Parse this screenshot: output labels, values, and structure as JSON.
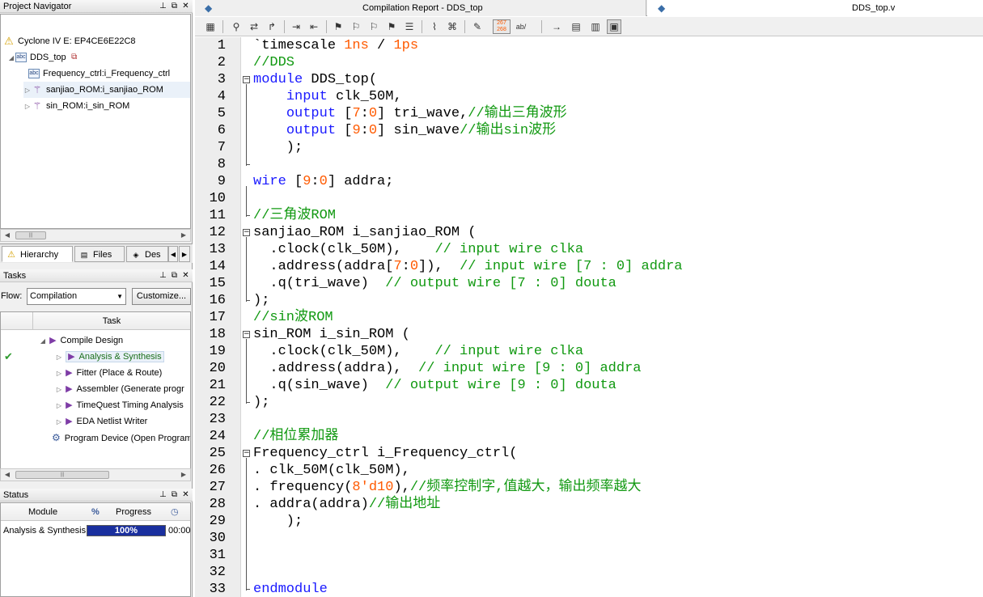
{
  "project_navigator": {
    "title": "Project Navigator",
    "device": "Cyclone IV E: EP4CE6E22C8",
    "top_entity": "DDS_top",
    "children": [
      "Frequency_ctrl:i_Frequency_ctrl",
      "sanjiao_ROM:i_sanjiao_ROM",
      "sin_ROM:i_sin_ROM"
    ],
    "tabs": [
      "Hierarchy",
      "Files",
      "Des"
    ]
  },
  "tasks": {
    "title": "Tasks",
    "flow_label": "Flow:",
    "flow_value": "Compilation",
    "customize_label": "Customize...",
    "column_header": "Task",
    "items": [
      "Compile Design",
      "Analysis & Synthesis",
      "Fitter (Place & Route)",
      "Assembler (Generate progr",
      "TimeQuest Timing Analysis",
      "EDA Netlist Writer",
      "Program Device (Open Program"
    ]
  },
  "status": {
    "title": "Status",
    "col_module": "Module",
    "col_pct": "%",
    "col_progress": "Progress",
    "row_module": "Analysis & Synthesis",
    "row_progress": "100%",
    "row_progress_value": 100,
    "row_time": "00:00"
  },
  "doc_tabs": {
    "compilation_report": "Compilation Report - DDS_top",
    "source_file": "DDS_top.v"
  },
  "editor": {
    "line_numbers": [
      "1",
      "2",
      "3",
      "4",
      "5",
      "6",
      "7",
      "8",
      "9",
      "10",
      "11",
      "12",
      "13",
      "14",
      "15",
      "16",
      "17",
      "18",
      "19",
      "20",
      "21",
      "22",
      "23",
      "24",
      "25",
      "26",
      "27",
      "28",
      "29",
      "30",
      "31",
      "32",
      "33"
    ],
    "lines": [
      "`timescale 1ns / 1ps",
      "//DDS",
      "module DDS_top(",
      "    input clk_50M,",
      "    output [7:0] tri_wave,//输出三角波形",
      "    output [9:0] sin_wave//输出sin波形",
      "    );",
      "",
      "wire [9:0] addra;",
      "",
      "//三角波ROM",
      "sanjiao_ROM i_sanjiao_ROM (",
      "  .clock(clk_50M),    // input wire clka",
      "  .address(addra[7:0]),  // input wire [7 : 0] addra",
      "  .q(tri_wave)  // output wire [7 : 0] douta",
      ");",
      "//sin波ROM",
      "sin_ROM i_sin_ROM (",
      "  .clock(clk_50M),    // input wire clka",
      "  .address(addra),  // input wire [9 : 0] addra",
      "  .q(sin_wave)  // output wire [9 : 0] douta",
      ");",
      "",
      "//相位累加器",
      "Frequency_ctrl i_Frequency_ctrl(",
      ". clk_50M(clk_50M),",
      ". frequency(8'd10),//频率控制字,值越大，输出频率越大",
      ". addra(addra)//输出地址",
      "    );",
      "",
      "",
      "",
      "endmodule"
    ]
  }
}
